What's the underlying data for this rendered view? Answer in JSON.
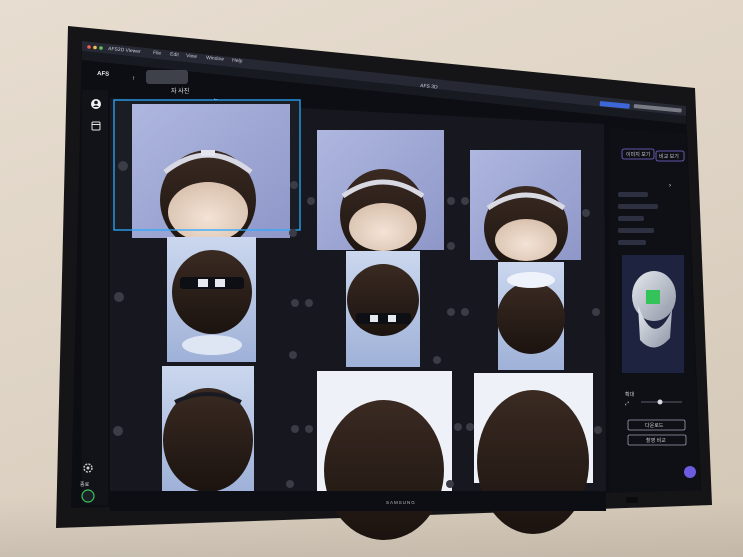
{
  "window": {
    "app_name": "AFS3D Viewer",
    "menu": [
      "File",
      "Edit",
      "View",
      "Window",
      "Help"
    ],
    "title": "AFS 3D"
  },
  "toolbar": {
    "brand": "AFS",
    "page_title": "자 사진",
    "back_arrow": "←",
    "forward_arrow": "→",
    "up_arrow": "↑"
  },
  "right_panel": {
    "tab_left": "이미지 보기",
    "tab_right": "비교 보기",
    "zoom_label": "확대",
    "button_download": "다운로드",
    "button_compare": "촬영 비교"
  },
  "sidebar": {
    "bottom_label": "종료"
  },
  "brand": "SAMSUNG",
  "icons": [
    "user-icon",
    "calendar-icon",
    "settings-icon",
    "zoom-icon",
    "chevron-right-icon"
  ],
  "accent_color": "#2aa9ff",
  "panel_bg": "#0f1016"
}
